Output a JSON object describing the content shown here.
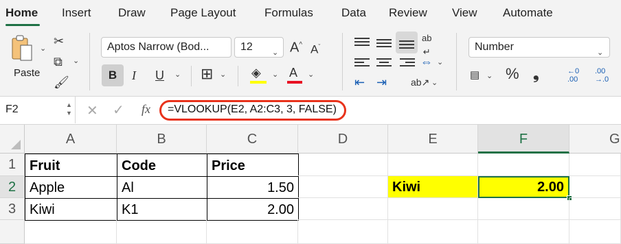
{
  "tabs": [
    "Home",
    "Insert",
    "Draw",
    "Page Layout",
    "Formulas",
    "Data",
    "Review",
    "View",
    "Automate"
  ],
  "ribbon": {
    "paste_label": "Paste",
    "font_name": "Aptos Narrow (Bod...",
    "font_size": "12",
    "number_format": "Number",
    "bold_label": "B",
    "italic_label": "I",
    "underline_label": "U",
    "grow_font": "A^",
    "shrink_font": "A",
    "percent": "%",
    "comma": "❟",
    "dec_inc_top": "←0",
    "dec_inc_bottom": ".00",
    "dec_dec_top": ".00",
    "dec_dec_bottom": "→.0",
    "highlight_color": "#ffff00",
    "font_color": "#e81123"
  },
  "formula_bar": {
    "name_box": "F2",
    "fx": "fx",
    "formula": "=VLOOKUP(E2, A2:C3, 3, FALSE)"
  },
  "sheet": {
    "columns": [
      "A",
      "B",
      "C",
      "D",
      "E",
      "F",
      "G"
    ],
    "rows": [
      "1",
      "2",
      "3",
      ""
    ],
    "cells": {
      "A1": "Fruit",
      "B1": "Code",
      "C1": "Price",
      "A2": "Apple",
      "B2": "Al",
      "C2": "1.50",
      "A3": "Kiwi",
      "B3": "K1",
      "C3": "2.00",
      "E2": "Kiwi",
      "F2": "2.00"
    }
  }
}
